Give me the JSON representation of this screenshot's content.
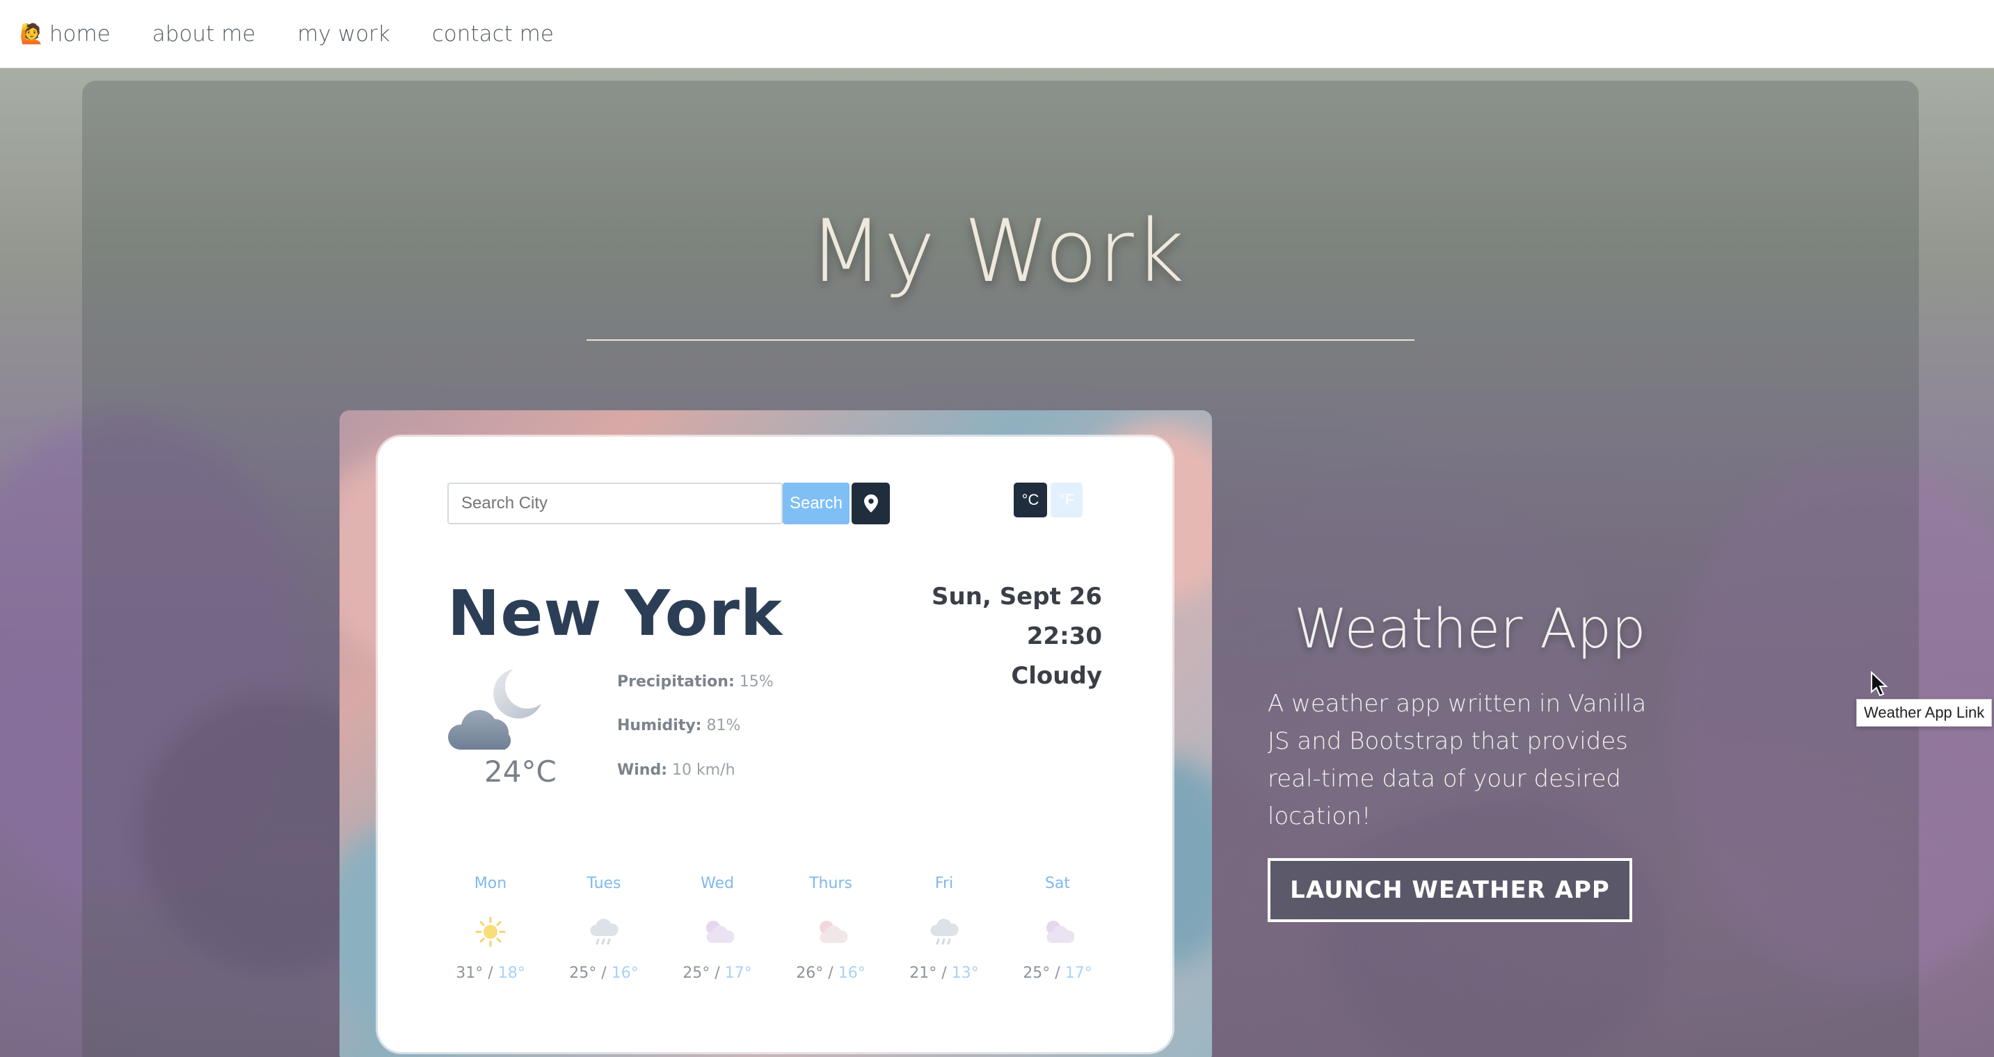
{
  "nav": {
    "items": [
      {
        "label": "home",
        "icon": "avatar-emoji"
      },
      {
        "label": "about me"
      },
      {
        "label": "my work"
      },
      {
        "label": "contact me"
      }
    ]
  },
  "page": {
    "title": "My Work"
  },
  "weather_app": {
    "search_placeholder": "Search City",
    "search_label": "Search",
    "unit_c": "°C",
    "unit_f": "°F",
    "city": "New York",
    "date": "Sun, Sept 26",
    "time": "22:30",
    "condition": "Cloudy",
    "temperature": "24°C",
    "details": [
      {
        "label": "Precipitation:",
        "value": "15%"
      },
      {
        "label": "Humidity:",
        "value": "81%"
      },
      {
        "label": "Wind:",
        "value": "10 km/h"
      }
    ],
    "forecast": [
      {
        "day": "Mon",
        "high": "31°",
        "low": "18°",
        "icon": "sun-icon"
      },
      {
        "day": "Tues",
        "high": "25°",
        "low": "16°",
        "icon": "rain-cloud-icon"
      },
      {
        "day": "Wed",
        "high": "25°",
        "low": "17°",
        "icon": "partly-cloudy-icon"
      },
      {
        "day": "Thurs",
        "high": "26°",
        "low": "16°",
        "icon": "partly-cloudy-icon"
      },
      {
        "day": "Fri",
        "high": "21°",
        "low": "13°",
        "icon": "rain-cloud-icon"
      },
      {
        "day": "Sat",
        "high": "25°",
        "low": "17°",
        "icon": "partly-cloudy-icon"
      }
    ]
  },
  "project": {
    "title": "Weather App",
    "description": "A weather app written in Vanilla JS and Bootstrap that provides real-time data of your desired location!",
    "button_label": "LAUNCH WEATHER APP",
    "tooltip": "Weather App Link"
  },
  "colors": {
    "accent_blue": "#7fbff5",
    "dark_navy": "#1f2d3d",
    "title_cream": "#efe9dd"
  }
}
